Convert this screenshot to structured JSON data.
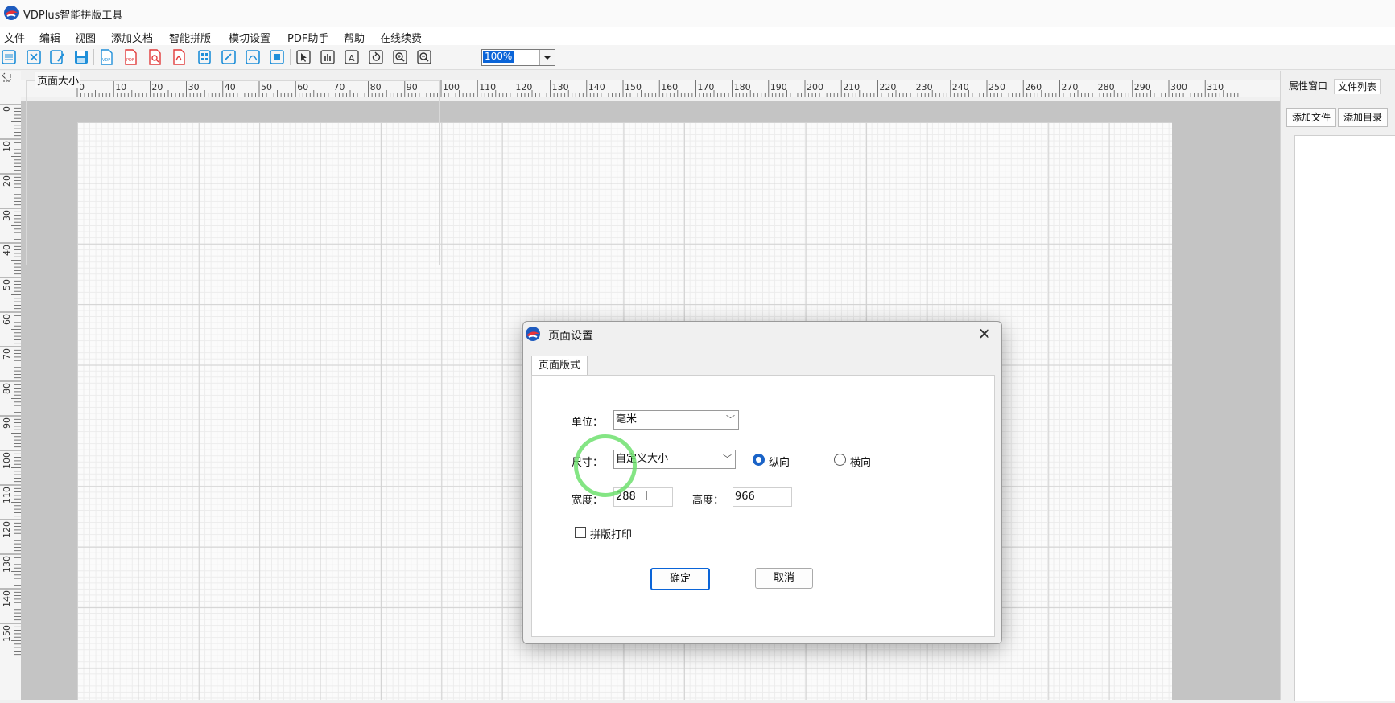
{
  "app": {
    "title": "VDPlus智能拼版工具"
  },
  "menu": [
    "文件",
    "编辑",
    "视图",
    "添加文档",
    "智能拼版",
    "模切设置",
    "PDF助手",
    "帮助",
    "在线续费"
  ],
  "toolbar": {
    "zoom_value": "100%"
  },
  "ruler": {
    "h_ticks": [
      "0",
      "10",
      "20",
      "30",
      "40",
      "50",
      "60",
      "70",
      "80",
      "90",
      "100",
      "110",
      "120",
      "130",
      "140",
      "150",
      "160",
      "170",
      "180",
      "190",
      "200",
      "210",
      "220",
      "230",
      "240",
      "250",
      "260",
      "270",
      "280",
      "290",
      "300",
      "310"
    ],
    "v_ticks": [
      "0",
      "10",
      "20",
      "30",
      "40",
      "50",
      "60",
      "70",
      "80",
      "90",
      "100",
      "110",
      "120",
      "130",
      "140",
      "150"
    ]
  },
  "right_panel": {
    "tabs": [
      "属性窗口",
      "文件列表"
    ],
    "buttons": [
      "添加文件",
      "添加目录"
    ]
  },
  "dialog": {
    "title": "页面设置",
    "tab": "页面版式",
    "group": "页面大小",
    "unit_label": "单位：",
    "unit_value": "毫米",
    "size_label": "尺寸：",
    "size_value": "自定义大小",
    "portrait_label": "纵向",
    "landscape_label": "横向",
    "orientation": "portrait",
    "width_label": "宽度：",
    "width_value": "288",
    "height_label": "高度：",
    "height_value": "966",
    "imposition_print_label": "拼版打印",
    "imposition_print_checked": false,
    "ok_label": "确定",
    "cancel_label": "取消"
  },
  "colors": {
    "accent": "#0a64d8",
    "cursor_highlight": "#6ee16e"
  }
}
